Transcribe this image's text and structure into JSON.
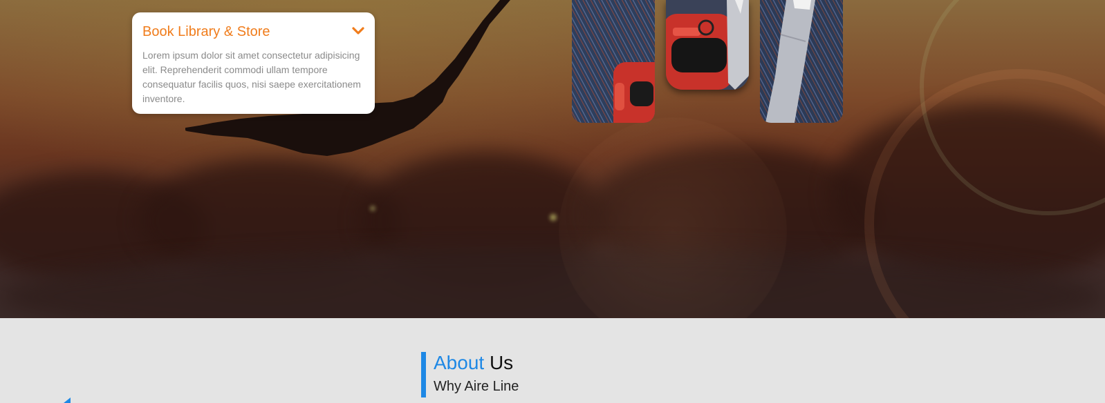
{
  "accordion": {
    "title": "Book Library & Store",
    "body": "Lorem ipsum dolor sit amet consectetur adipisicing elit. Reprehenderit commodi ullam tempore consequatur facilis quos, nisi saepe exercitationem inventore.",
    "toggle_icon": "chevron-down-icon"
  },
  "about": {
    "heading_accent": "About",
    "heading_rest": "Us",
    "subtitle": "Why Aire Line"
  },
  "colors": {
    "accordion_accent": "#f07c1b",
    "about_accent": "#1e88e5",
    "section_background": "#e4e4e4"
  }
}
